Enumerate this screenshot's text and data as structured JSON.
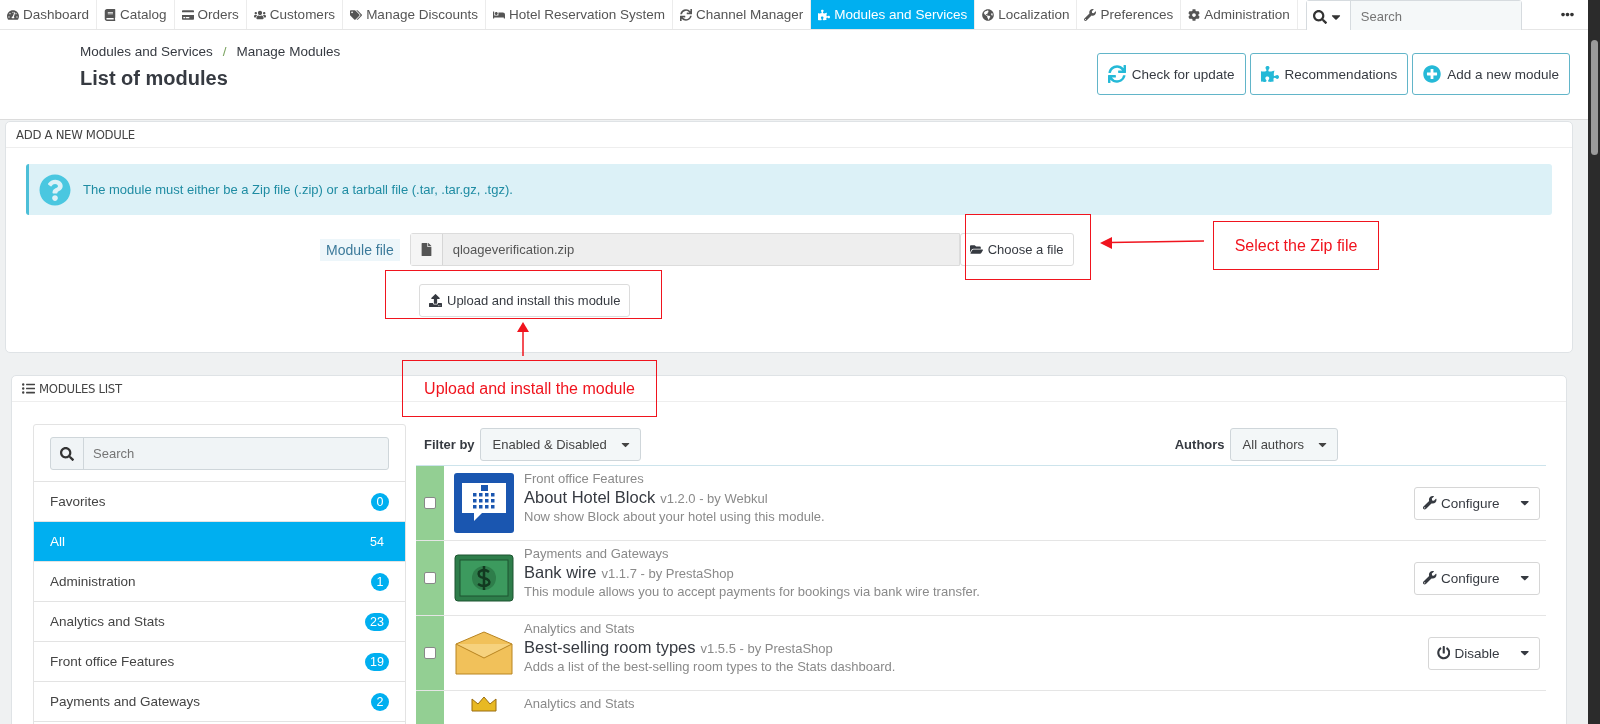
{
  "nav": {
    "items": [
      {
        "label": "Dashboard",
        "selected": false
      },
      {
        "label": "Catalog",
        "selected": false
      },
      {
        "label": "Orders",
        "selected": false
      },
      {
        "label": "Customers",
        "selected": false
      },
      {
        "label": "Manage Discounts",
        "selected": false
      },
      {
        "label": "Hotel Reservation System",
        "selected": false
      },
      {
        "label": "Channel Manager",
        "selected": false
      },
      {
        "label": "Modules and Services",
        "selected": true
      },
      {
        "label": "Localization",
        "selected": false
      },
      {
        "label": "Preferences",
        "selected": false
      },
      {
        "label": "Administration",
        "selected": false
      }
    ],
    "search": {
      "placeholder": "Search"
    }
  },
  "header": {
    "breadcrumb": [
      "Modules and Services",
      "Manage Modules"
    ],
    "separator": "/",
    "title": "List of modules",
    "buttons": [
      "Check for update",
      "Recommendations",
      "Add a new module"
    ]
  },
  "add_module": {
    "heading": "ADD A NEW MODULE",
    "alert": "The module must either be a Zip file (.zip) or a tarball file (.tar, .tar.gz, .tgz).",
    "file_label": "Module file",
    "file_value": "qloageverification.zip",
    "choose_button": "Choose a file",
    "upload_button": "Upload and install this module"
  },
  "annotations": [
    {
      "kind": "upload",
      "text": "Upload and install the module"
    },
    {
      "kind": "choose",
      "text": "Select the Zip file"
    }
  ],
  "modules_list": {
    "heading": "MODULES LIST",
    "search": {
      "placeholder": "Search"
    },
    "categories": [
      {
        "label": "Favorites",
        "count": "0",
        "selected": false
      },
      {
        "label": "All",
        "count": "54",
        "selected": true
      },
      {
        "label": "Administration",
        "count": "1",
        "selected": false
      },
      {
        "label": "Analytics and Stats",
        "count": "23",
        "selected": false
      },
      {
        "label": "Front office Features",
        "count": "19",
        "selected": false
      },
      {
        "label": "Payments and Gateways",
        "count": "2",
        "selected": false
      }
    ],
    "filter_label": "Filter by",
    "filter_value": "Enabled & Disabled",
    "authors_label": "Authors",
    "authors_value": "All authors",
    "modules": [
      {
        "category": "Front office Features",
        "name": "About Hotel Block",
        "version": "v1.2.0 - by Webkul",
        "description": "Now show Block about your hotel using this module.",
        "enabled": true,
        "checked": false,
        "action": {
          "kind": "configure",
          "label": "Configure"
        }
      },
      {
        "category": "Payments and Gateways",
        "name": "Bank wire",
        "version": "v1.1.7 - by PrestaShop",
        "description": "This module allows you to accept payments for bookings via bank wire transfer.",
        "enabled": true,
        "checked": false,
        "action": {
          "kind": "configure",
          "label": "Configure"
        }
      },
      {
        "category": "Analytics and Stats",
        "name": "Best-selling room types",
        "version": "v1.5.5 - by PrestaShop",
        "description": "Adds a list of the best-selling room types to the Stats dashboard.",
        "enabled": true,
        "checked": false,
        "action": {
          "kind": "disable",
          "label": "Disable"
        }
      },
      {
        "category": "Analytics and Stats",
        "enabled": true
      }
    ]
  }
}
